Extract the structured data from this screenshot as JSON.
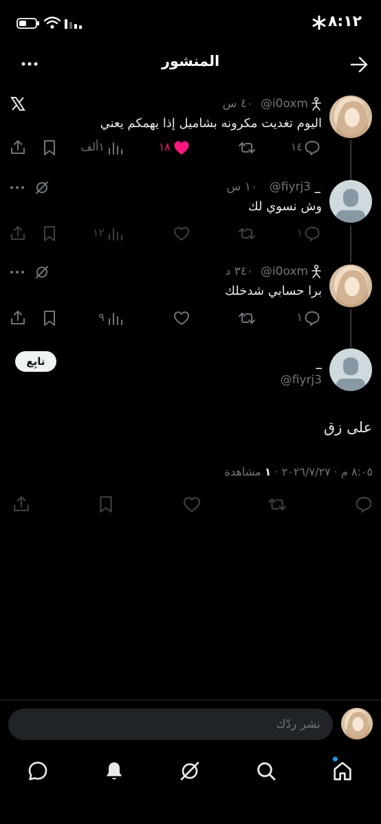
{
  "status_bar": {
    "time": "٨:١٢"
  },
  "header": {
    "title": "المنشور"
  },
  "tweets": [
    {
      "handle": "@i0oxm",
      "time": "٤٠ س",
      "text": "اليوم تغديت مكرونه بشاميل إذا يهمكم يعني",
      "replies": "١٤",
      "likes": "١٨",
      "views": "١ألف"
    },
    {
      "name": "_",
      "handle": "@fiyrj3",
      "time": "١٠ س",
      "text": "وش نسوي لك",
      "replies": "١",
      "views": "١٢"
    },
    {
      "handle": "@i0oxm",
      "time": "٣٤٠ د",
      "text": "برا حسابي شدخلك",
      "replies": "١",
      "views": "٩"
    }
  ],
  "main_post": {
    "name": "_",
    "handle": "@fiyrj3",
    "follow_label": "تابِع",
    "text": "على زق",
    "timestamp": "٨:٠٥ م · ٢٠٢٦/٧/٢٧",
    "views_count": "١",
    "views_label": "مشاهدة"
  },
  "reply_bar": {
    "placeholder": "نشر ردّك"
  },
  "colors": {
    "like_active": "#f91880",
    "accent_dot": "#1d9bf0",
    "muted": "#71767b"
  }
}
